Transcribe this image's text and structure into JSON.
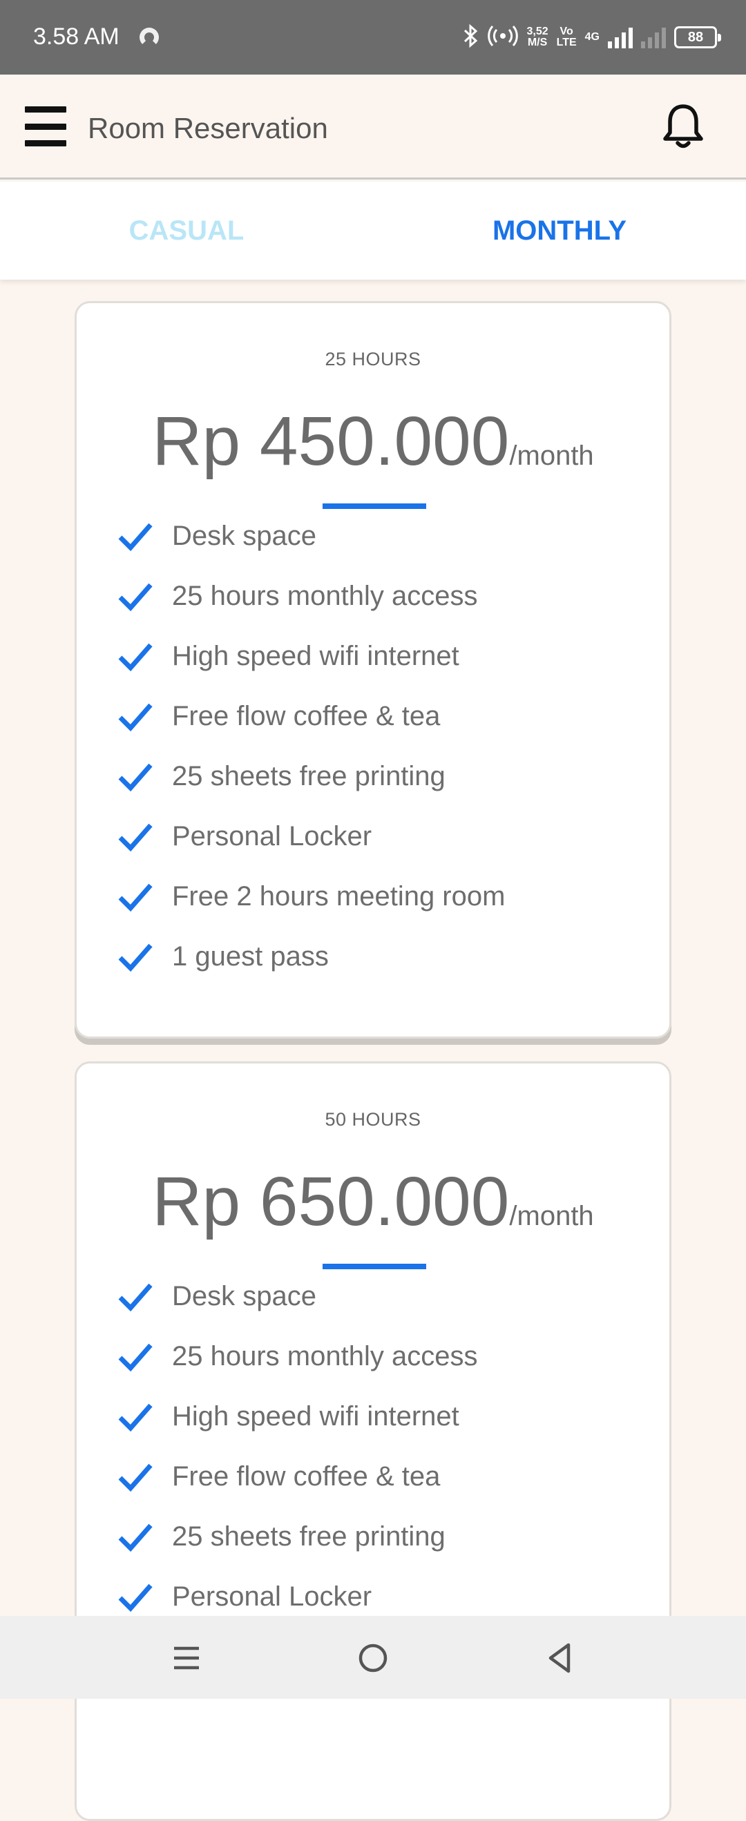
{
  "status_bar": {
    "time": "3.58 AM",
    "network_speed": "3,52",
    "network_speed_unit": "M/S",
    "volte_top": "Vo",
    "volte_bottom": "LTE",
    "lte_label": "4G",
    "battery": "88"
  },
  "app_bar": {
    "title": "Room Reservation"
  },
  "tabs": [
    {
      "label": "CASUAL",
      "selected": false
    },
    {
      "label": "MONTHLY",
      "selected": true
    }
  ],
  "plans": [
    {
      "name": "25 HOURS",
      "price": "Rp 450.000",
      "period": "/month",
      "features": [
        "Desk space",
        "25 hours monthly access",
        "High speed wifi internet",
        "Free flow coffee & tea",
        "25 sheets free printing",
        "Personal Locker",
        "Free 2 hours meeting room",
        "1 guest pass"
      ]
    },
    {
      "name": "50 HOURS",
      "price": "Rp 650.000",
      "period": "/month",
      "features": [
        "Desk space",
        "25 hours monthly access",
        "High speed wifi internet",
        "Free flow coffee & tea",
        "25 sheets free printing",
        "Personal Locker"
      ]
    }
  ],
  "colors": {
    "accent": "#1a73e8",
    "tab_inactive": "#b9e6f7",
    "background": "#fcf5ef"
  },
  "icons": {
    "menu": "hamburger-menu-icon",
    "notifications": "bell-icon",
    "check": "checkmark-icon",
    "nav_recent": "recent-apps-icon",
    "nav_home": "home-circle-icon",
    "nav_back": "back-triangle-icon"
  }
}
